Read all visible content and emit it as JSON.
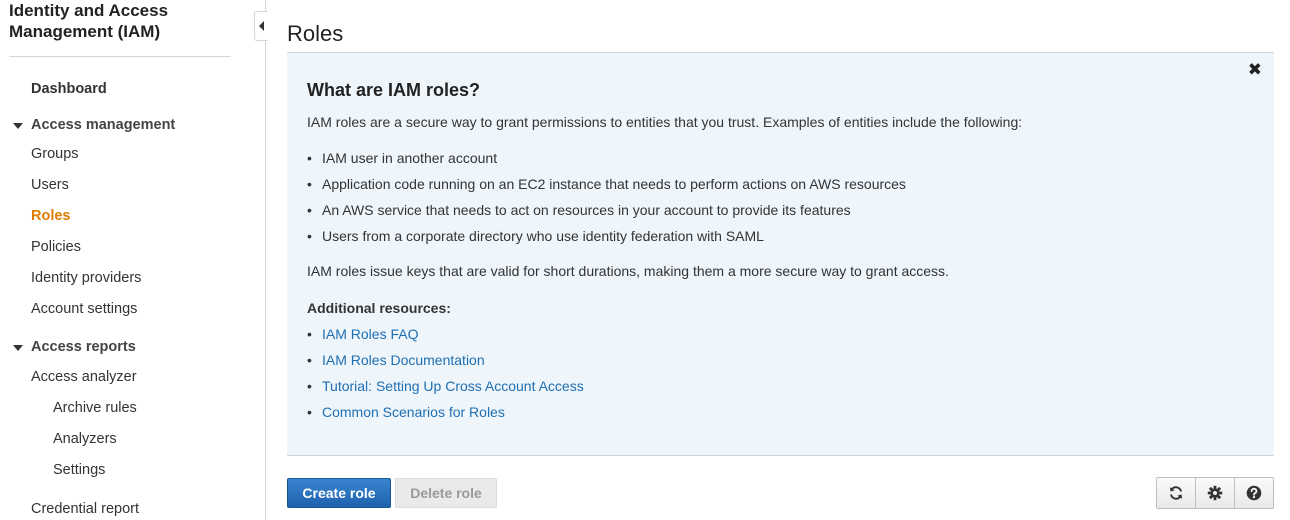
{
  "sidebar": {
    "title": "Identity and Access Management (IAM)",
    "dashboard": "Dashboard",
    "access_management": {
      "label": "Access management",
      "items": [
        "Groups",
        "Users",
        "Roles",
        "Policies",
        "Identity providers",
        "Account settings"
      ],
      "active": "Roles"
    },
    "access_reports": {
      "label": "Access reports",
      "analyzer": "Access analyzer",
      "sub_items": [
        "Archive rules",
        "Analyzers",
        "Settings"
      ],
      "credential_report": "Credential report"
    }
  },
  "main": {
    "title": "Roles",
    "info": {
      "heading": "What are IAM roles?",
      "intro": "IAM roles are a secure way to grant permissions to entities that you trust. Examples of entities include the following:",
      "bullets": [
        "IAM user in another account",
        "Application code running on an EC2 instance that needs to perform actions on AWS resources",
        "An AWS service that needs to act on resources in your account to provide its features",
        "Users from a corporate directory who use identity federation with SAML"
      ],
      "summary": "IAM roles issue keys that are valid for short durations, making them a more secure way to grant access.",
      "resources_label": "Additional resources:",
      "links": [
        "IAM Roles FAQ",
        "IAM Roles Documentation",
        "Tutorial: Setting Up Cross Account Access",
        "Common Scenarios for Roles"
      ],
      "close_glyph": "✖"
    },
    "buttons": {
      "create": "Create role",
      "delete": "Delete role"
    },
    "toolbar_icons": [
      "refresh-icon",
      "gear-icon",
      "help-icon"
    ]
  },
  "colors": {
    "accent_active": "#e07b00",
    "link": "#1f6fb2",
    "primary_button": "#1e61ad",
    "info_panel_bg": "#eef5fb"
  }
}
